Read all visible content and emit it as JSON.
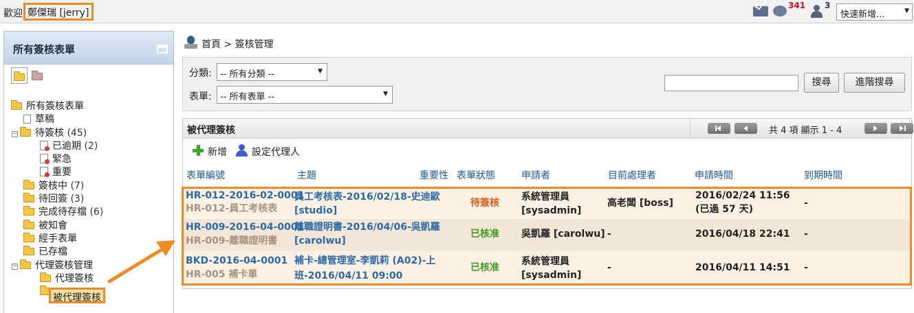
{
  "topbar": {
    "welcome": "歡迎",
    "user": "鄭傑瑞 [jerry]",
    "chat_count": "341",
    "user_count": "3",
    "quick_add": "快速新增..."
  },
  "sidebar": {
    "title": "所有簽核表單",
    "tree": [
      {
        "label": "所有簽核表單",
        "count": ""
      },
      {
        "label": "草稿",
        "count": ""
      },
      {
        "label": "待簽核",
        "count": "(45)"
      },
      {
        "label": "已逾期",
        "count": "(2)"
      },
      {
        "label": "緊急",
        "count": ""
      },
      {
        "label": "重要",
        "count": ""
      },
      {
        "label": "簽核中",
        "count": "(7)"
      },
      {
        "label": "待回簽",
        "count": "(3)"
      },
      {
        "label": "完成待存檔",
        "count": "(6)"
      },
      {
        "label": "被知會",
        "count": ""
      },
      {
        "label": "經手表單",
        "count": ""
      },
      {
        "label": "已存檔",
        "count": ""
      },
      {
        "label": "代理簽核管理",
        "count": ""
      },
      {
        "label": "代理簽核",
        "count": ""
      },
      {
        "label": "被代理簽核",
        "count": ""
      }
    ]
  },
  "breadcrumb": {
    "home": "首頁",
    "separator": ">",
    "current": "簽核管理"
  },
  "filters": {
    "category_label": "分類:",
    "category_value": "-- 所有分類 --",
    "form_label": "表單:",
    "form_value": "-- 所有表單 --",
    "search_value": "",
    "search_button": "搜尋",
    "advanced_button": "進階搜尋"
  },
  "panel": {
    "title": "被代理簽核",
    "pager_text": "共 4 項 顯示 1 - 4",
    "add_label": "新增",
    "delegate_label": "設定代理人"
  },
  "table": {
    "headers": [
      "表單編號",
      "主題",
      "重要性",
      "表單狀態",
      "申請者",
      "目前處理者",
      "申請時間",
      "到期時間"
    ],
    "rows": [
      {
        "form_no": "HR-012-2016-02-0001",
        "form_type": "HR-012-員工考核表",
        "subject_1": "員工考核表-2016/02/18-史迪歐",
        "subject_2": "[studio]",
        "status": "待簽核",
        "applicant_1": "系統管理員",
        "applicant_2": "[sysadmin]",
        "handler": "高老闆 [boss]",
        "time_1": "2016/02/24 11:56",
        "time_2": "(已過 57 天)",
        "due": "-"
      },
      {
        "form_no": "HR-009-2016-04-0001",
        "form_type": "HR-009-離職證明書",
        "subject_1": "離職證明書-2016/04/06-吳凱羅",
        "subject_2": "[carolwu]",
        "status": "已核准",
        "applicant_1": "吳凱羅 [carolwu]",
        "applicant_2": "",
        "handler": "-",
        "time_1": "2016/04/18 22:41",
        "time_2": "",
        "due": "-"
      },
      {
        "form_no": "BKD-2016-04-0001",
        "form_type": "HR-005 補卡單",
        "subject_1": "補卡-總管理室-李凱莉 (A02)-上",
        "subject_2": "班-2016/04/11 09:00",
        "status": "已核准",
        "applicant_1": "系統管理員",
        "applicant_2": "[sysadmin]",
        "handler": "-",
        "time_1": "2016/04/11 14:51",
        "time_2": "",
        "due": "-"
      }
    ]
  }
}
